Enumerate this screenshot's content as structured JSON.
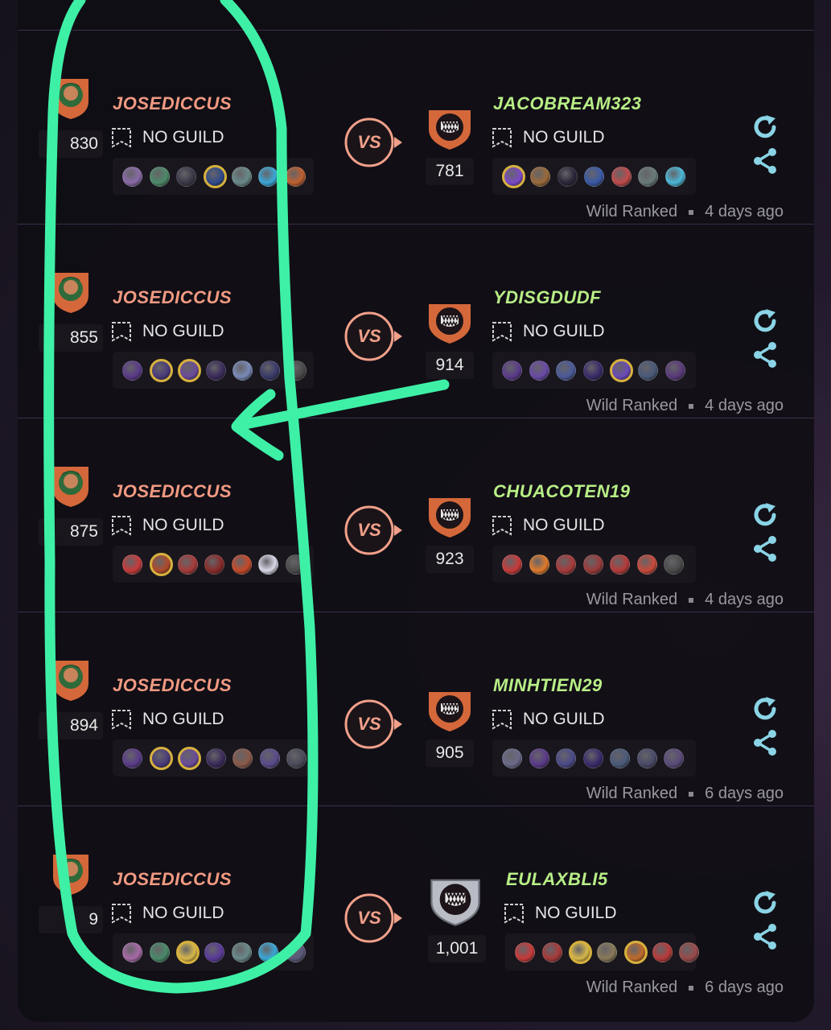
{
  "matches": [
    {
      "player": {
        "name": "JOSEDICCUS",
        "guild": "NO GUILD",
        "rating": "830"
      },
      "vs_label": "VS",
      "opponent": {
        "name": "JACOBREAM323",
        "guild": "NO GUILD",
        "rating": "781"
      },
      "mode": "Wild Ranked",
      "time": "4 days ago",
      "player_team": [
        "#8a6aa8",
        "#4d8a6a",
        "#3a3848",
        "#2e4a8a",
        "#6a8a8a",
        "#3aa8d8",
        "#c06030"
      ],
      "player_gold": [
        3
      ],
      "opp_team": [
        "#7a4ac8",
        "#9a6a3a",
        "#2a2438",
        "#3a5aa8",
        "#c04a4a",
        "#6a7a7a",
        "#4ab8d8"
      ],
      "opp_gold": [
        0
      ],
      "badge": "orange"
    },
    {
      "player": {
        "name": "JOSEDICCUS",
        "guild": "NO GUILD",
        "rating": "855"
      },
      "vs_label": "VS",
      "opponent": {
        "name": "YDISGDUDF",
        "guild": "NO GUILD",
        "rating": "914"
      },
      "mode": "Wild Ranked",
      "time": "4 days ago",
      "player_team": [
        "#5a3a8a",
        "#4a3a7a",
        "#6a4a9a",
        "#3a2a5a",
        "#7a8ab8",
        "#3a3a6a",
        "#4a4a4a"
      ],
      "player_gold": [
        1,
        2
      ],
      "opp_team": [
        "#5a3a8a",
        "#6a4aa8",
        "#4a5a9a",
        "#3a2a6a",
        "#6a4ab8",
        "#4a5a7a",
        "#5a3a7a"
      ],
      "opp_gold": [
        4
      ],
      "badge": "orange"
    },
    {
      "player": {
        "name": "JOSEDICCUS",
        "guild": "NO GUILD",
        "rating": "875"
      },
      "vs_label": "VS",
      "opponent": {
        "name": "CHUACOTEN19",
        "guild": "NO GUILD",
        "rating": "923"
      },
      "mode": "Wild Ranked",
      "time": "4 days ago",
      "player_team": [
        "#c83a3a",
        "#b04a2a",
        "#a83a3a",
        "#8a2a2a",
        "#c84a2a",
        "#d8d8e8",
        "#4a4a4a"
      ],
      "player_gold": [
        1
      ],
      "opp_team": [
        "#c83a3a",
        "#e07a2a",
        "#a83a3a",
        "#9a3a3a",
        "#b83a3a",
        "#c84a3a",
        "#4a4a4a"
      ],
      "opp_gold": [],
      "badge": "orange"
    },
    {
      "player": {
        "name": "JOSEDICCUS",
        "guild": "NO GUILD",
        "rating": "894"
      },
      "vs_label": "VS",
      "opponent": {
        "name": "MINHTIEN29",
        "guild": "NO GUILD",
        "rating": "905"
      },
      "mode": "Wild Ranked",
      "time": "6 days ago",
      "player_team": [
        "#5a3a8a",
        "#4a3a7a",
        "#6a4a9a",
        "#3a2a5a",
        "#8a5a4a",
        "#5a4a8a",
        "#4a4a5a"
      ],
      "player_gold": [
        1,
        2
      ],
      "opp_team": [
        "#6a6a8a",
        "#5a3a8a",
        "#4a4a8a",
        "#3a2a6a",
        "#4a5a7a",
        "#4a4a6a",
        "#5a4a7a"
      ],
      "opp_gold": [],
      "badge": "orange"
    },
    {
      "player": {
        "name": "JOSEDICCUS",
        "guild": "NO GUILD",
        "rating": "9"
      },
      "vs_label": "VS",
      "opponent": {
        "name": "EULAXBLI5",
        "guild": "NO GUILD",
        "rating": "1,001"
      },
      "mode": "Wild Ranked",
      "time": "6 days ago",
      "player_team": [
        "#a86aa8",
        "#4a8a6a",
        "#d8b84a",
        "#5a3a9a",
        "#6a8a8a",
        "#3aa8d8",
        "#5a5a7a"
      ],
      "player_gold": [
        2
      ],
      "opp_team": [
        "#c83a3a",
        "#a83a3a",
        "#d8b84a",
        "#8a7a5a",
        "#c06a2a",
        "#b83a3a",
        "#9a4a4a"
      ],
      "opp_gold": [
        2,
        4
      ],
      "badge": "silver"
    }
  ],
  "colors": {
    "player_name": "#f19a82",
    "opponent_name": "#b8ee86",
    "annotation": "#3ef0a6",
    "refresh_icon": "#8ad4e6"
  }
}
